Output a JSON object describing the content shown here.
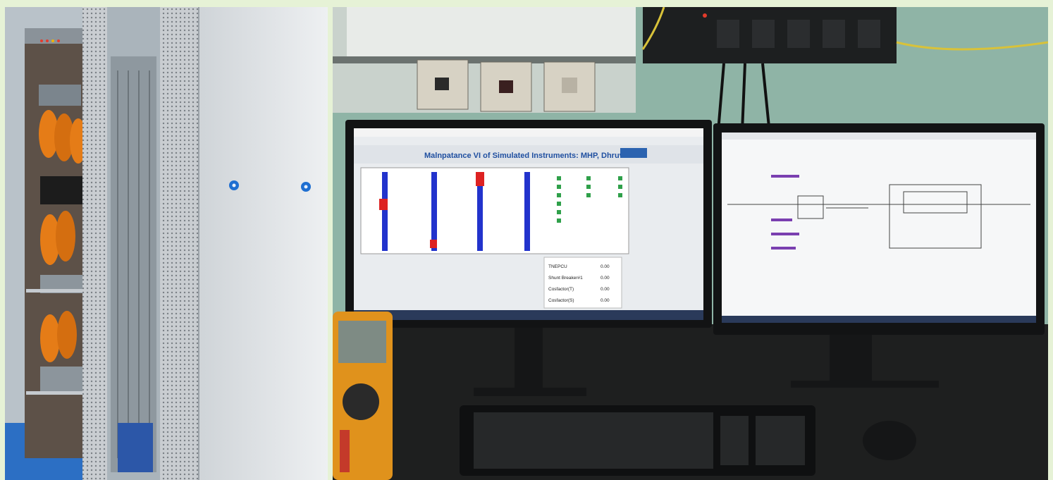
{
  "image": {
    "left_panel": "control-cabinet",
    "right_panel": "workstation"
  },
  "monitor_left": {
    "title": "Malnpatance VI of Simulated Instruments: MHP, Dhruve",
    "readouts": [
      {
        "label": "TNEPCU",
        "value": "0.00"
      },
      {
        "label": "Shunt Breaker#1",
        "value": "0.00"
      },
      {
        "label": "Cosfactor(T)",
        "value": "0.00"
      },
      {
        "label": "Cosfactor(S)",
        "value": "0.00"
      }
    ]
  },
  "colors": {
    "border": "#e6f2d6",
    "screen_blue": "#1f4fa0",
    "indicator_blue": "#2233cc",
    "indicator_red": "#dd2222",
    "indicator_green": "#2fa04a"
  }
}
